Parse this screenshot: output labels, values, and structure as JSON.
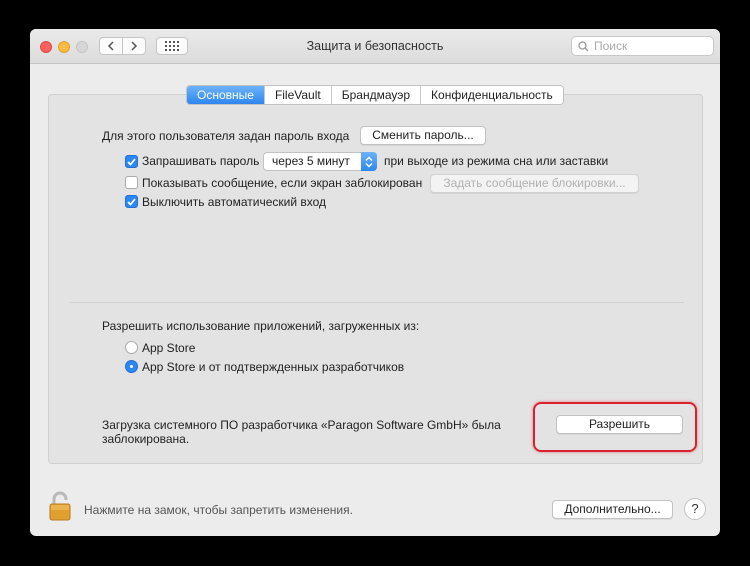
{
  "window": {
    "title": "Защита и безопасность",
    "search_placeholder": "Поиск"
  },
  "tabs": [
    {
      "label": "Основные",
      "active": true
    },
    {
      "label": "FileVault",
      "active": false
    },
    {
      "label": "Брандмауэр",
      "active": false
    },
    {
      "label": "Конфиденциальность",
      "active": false
    }
  ],
  "general": {
    "password_label": "Для этого пользователя задан пароль входа",
    "change_password_button": "Сменить пароль...",
    "require_password_label": "Запрашивать пароль",
    "require_password_checked": true,
    "require_password_delay": "через 5 минут",
    "require_password_suffix": "при выходе из режима сна или заставки",
    "show_message_label": "Показывать сообщение, если экран заблокирован",
    "show_message_checked": false,
    "set_message_button": "Задать сообщение блокировки...",
    "disable_autologin_label": "Выключить автоматический вход",
    "disable_autologin_checked": true
  },
  "apps": {
    "heading": "Разрешить использование приложений, загруженных из:",
    "option_app_store": "App Store",
    "option_identified": "App Store и от подтвержденных разработчиков",
    "selected": "App Store и от подтвержденных разработчиков"
  },
  "blocked": {
    "line1": "Загрузка системного ПО разработчика «Paragon Software GmbH» была",
    "line2": "заблокирована.",
    "allow_button": "Разрешить"
  },
  "footer": {
    "lock_text": "Нажмите на замок, чтобы запретить изменения.",
    "advanced_button": "Дополнительно...",
    "help_label": "?"
  },
  "colors": {
    "accent": "#2f86ef",
    "highlight": "#d6232f"
  }
}
